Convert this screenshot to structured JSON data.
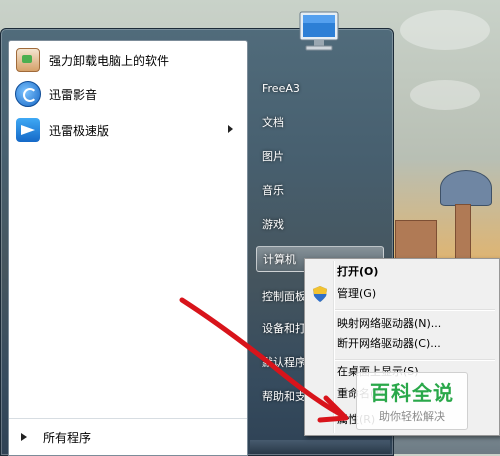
{
  "programs": [
    {
      "label": "强力卸载电脑上的软件",
      "icon": "uninstaller-icon"
    },
    {
      "label": "迅雷影音",
      "icon": "xunlei-player-icon"
    },
    {
      "label": "迅雷极速版",
      "icon": "xunlei-bird-icon",
      "has_submenu": true
    }
  ],
  "all_programs_label": "所有程序",
  "right_pane": {
    "items": [
      {
        "label": "FreeA3"
      },
      {
        "label": "文档"
      },
      {
        "label": "图片"
      },
      {
        "label": "音乐"
      },
      {
        "label": "游戏"
      },
      {
        "label": "计算机",
        "highlighted": true
      },
      {
        "label": "控制面板"
      },
      {
        "label": "设备和打"
      },
      {
        "label": "默认程序"
      },
      {
        "label": "帮助和支"
      }
    ]
  },
  "context_menu": {
    "items": [
      {
        "label": "打开(O)",
        "bold": true
      },
      {
        "label": "管理(G)",
        "icon": "uac-shield-icon"
      },
      {
        "label": "映射网络驱动器(N)..."
      },
      {
        "label": "断开网络驱动器(C)..."
      },
      {
        "label": "在桌面上显示(S)"
      },
      {
        "label": "重命名(M)"
      },
      {
        "label": "属性(R)"
      }
    ]
  },
  "watermark": {
    "title": "百科全说",
    "subtitle": "助你轻松解决"
  },
  "colors": {
    "annotation_arrow": "#d8141b",
    "watermark_green": "#2aa84a"
  }
}
